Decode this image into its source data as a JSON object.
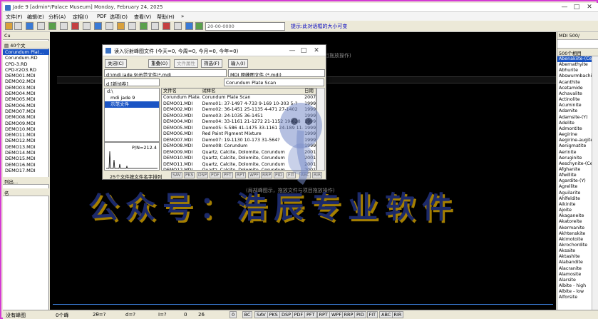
{
  "title_bar": {
    "title": "Jade 9 [admin*/Palace Museum] Monday, February 24, 2025",
    "minimize": "—",
    "maximize": "□",
    "close": "✕"
  },
  "menu": [
    "文件(F)",
    "编辑(E)",
    "分析(A)",
    "定相(I)",
    "PDF",
    "选项(O)",
    "查看(V)",
    "帮助(H)",
    "»"
  ],
  "toolbar": {
    "input_value": "20-00-0000",
    "hint": "提示:此对话框的大小可变"
  },
  "left_panel": {
    "dropdown_label": "Cu",
    "files_header": "40个文",
    "files": [
      "Corundum Plat...",
      "Corundum.RD",
      "CPD-3.RD",
      "CPD-Y2O3.RD",
      "DEMO01.MDI",
      "DEMO02.MDI",
      "DEMO03.MDI",
      "DEMO04.MDI",
      "DEMO05.MDI",
      "DEMO06.MDI",
      "DEMO07.MDI",
      "DEMO08.MDI",
      "DEMO09.MDI",
      "DEMO10.MDI",
      "DEMO11.MDI",
      "DEMO12.MDI",
      "DEMO13.MDI",
      "DEMO14.MDI",
      "DEMO15.MDI",
      "DEMO16.MDI",
      "DEMO17.MDI"
    ],
    "selected_file": "Corundum Plat...",
    "bottom_header": "列出...",
    "bottom_label": "名"
  },
  "main": {
    "ghost_top": "目拖放操作)",
    "ghost_mid": "(局部峰图示，拖放文件与项目拖放操作)",
    "watermark": "公众号：浩辰专业软件"
  },
  "right_panel": {
    "dropdown": "MDI 500/",
    "header": "500个相目",
    "minerals": [
      "Abenakiite-(Ce)",
      "Abernathyite",
      "Abhurite",
      "Abswurmbachite",
      "Acanthite",
      "Acetamide",
      "Achavalite",
      "Actinolite",
      "Acuminite",
      "Adamite",
      "Adamsite-(Y)",
      "Adelite",
      "Admontite",
      "Aegirine",
      "Aegirine-augite",
      "Aenigmatite",
      "Aerinite",
      "Aeruginite",
      "Aeschynite-(Ce)",
      "Afghanite",
      "Afwillite",
      "Agardite-(Y)",
      "Agrellite",
      "Aguilarite",
      "Ahlfeldite",
      "Aikinite",
      "Ajoite",
      "Akaganeite",
      "Akatoreite",
      "Akermanite",
      "Akhtenskite",
      "Akimotoite",
      "Akrochordite",
      "Aksaite",
      "Aktashite",
      "Alabandite",
      "Alacranite",
      "Alamosite",
      "Alarsite",
      "Albite - high",
      "Albite - low",
      "Alforsite"
    ],
    "selected": "Abenakiite-(Ce)"
  },
  "status": {
    "label": "没有峰图",
    "peaks": "0个峰",
    "two_theta": "2θ=?",
    "d": "d=?",
    "i": "I=?",
    "zero": "0",
    "value": "26",
    "buttons": [
      "0",
      "BC",
      "SAV",
      "PKS",
      "DSP",
      "PDF",
      "PFT",
      "RPT",
      "WPF",
      "RRP",
      "PID",
      "FIT",
      "ABC",
      "RIR"
    ]
  },
  "dialog": {
    "title": "读入衍射峰图文件 (今天=0, 今周=0, 今月=0, 今年=0)",
    "buttons_row1": [
      "关闭(C)",
      "重叠(O)",
      "文件属性",
      "筛选(F)",
      "输入(I)"
    ],
    "path": "d:\\mdi jade 9\\示范文件\\*.mdi",
    "filter": "MDI 原峰图文件 (*.mdi)",
    "drive": "d [新加卷]",
    "project_select": "Corundum Plate Scan",
    "tree": [
      "d:\\",
      "mdi jade 9",
      "示范文件"
    ],
    "columns": [
      "文件名",
      "试样名",
      "日期"
    ],
    "rows": [
      [
        "Corundum Plate...",
        "Corundum Plate Scan",
        "2007"
      ],
      [
        "DEMO01.MDI",
        "Demo01: 37-1497 4-733 9-169 10-303 5-?",
        "1999"
      ],
      [
        "DEMO02.MDI",
        "Demo02: 36-1451 25-1135 4-471 27-1402",
        "1999"
      ],
      [
        "DEMO03.MDI",
        "Demo03: 24-1035 36-1451",
        "1999"
      ],
      [
        "DEMO04.MDI",
        "Demo04: 33-1161 21-1272 21-1152 19-628",
        "1999"
      ],
      [
        "DEMO05.MDI",
        "Demo05: 5-586 41-1475 33-1161 24-189 11-46?",
        "1999"
      ],
      [
        "DEMO06.MDI",
        "Red Paint Pigment Mixture",
        "1999"
      ],
      [
        "DEMO07.MDI",
        "Demo07: 19-1130 10-173 31-564?",
        "1999"
      ],
      [
        "DEMO08.MDI",
        "Demo08: Corundum",
        "1999"
      ],
      [
        "DEMO09.MDI",
        "Quartz, Calcite, Dolomite, Corundum",
        "2001"
      ],
      [
        "DEMO10.MDI",
        "Quartz, Calcite, Dolomite, Corundum",
        "2001"
      ],
      [
        "DEMO11.MDI",
        "Quartz, Calcite, Dolomite, Corundum",
        "2001"
      ],
      [
        "DEMO12.MDI",
        "Quartz, Calcite, Dolomite, Corundum",
        "2001"
      ]
    ],
    "preview_label": "P/N=212.4",
    "count": "25个文件按文件名字排列",
    "foot_buttons": [
      "SAV",
      "PKS",
      "DSP",
      "PDF",
      "PFT",
      "RPT",
      "WPF",
      "RRP",
      "PID",
      "FIT",
      "ABC",
      "RIR"
    ]
  }
}
